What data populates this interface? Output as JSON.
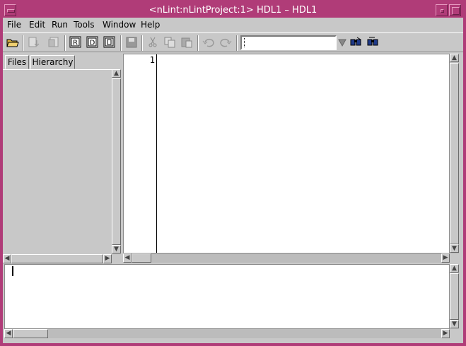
{
  "window": {
    "title": "<nLint:nLintProject:1> HDL1 – HDL1",
    "frame_color": "#b03c78"
  },
  "menu": {
    "items": [
      {
        "label": "File"
      },
      {
        "label": "Edit"
      },
      {
        "label": "Run"
      },
      {
        "label": "Tools"
      },
      {
        "label": "Window"
      },
      {
        "label": "Help"
      }
    ]
  },
  "toolbar": {
    "icons": [
      "open-folder-icon",
      "compile-icon",
      "paste-box-icon",
      "report-r-icon",
      "debug-d-icon",
      "document-icon",
      "save-icon",
      "cut-icon",
      "copy-icon",
      "paste-icon",
      "undo-icon",
      "redo-icon",
      "find-icon",
      "find-next-icon"
    ],
    "search_value": ""
  },
  "left_panel": {
    "tabs": [
      {
        "label": "Files"
      },
      {
        "label": "Hierarchy"
      }
    ]
  },
  "editor": {
    "line_numbers": [
      "1"
    ],
    "content": ""
  },
  "console": {
    "content": ""
  }
}
